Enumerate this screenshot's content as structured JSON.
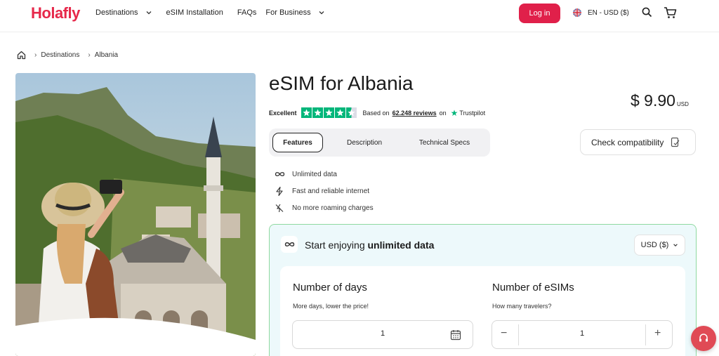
{
  "header": {
    "logo": "Holafly",
    "nav": [
      {
        "label": "Destinations",
        "has_dropdown": true
      },
      {
        "label": "eSIM Installation",
        "has_dropdown": false
      },
      {
        "label": "FAQs",
        "has_dropdown": false
      },
      {
        "label": "For Business",
        "has_dropdown": true
      }
    ],
    "login_label": "Log in",
    "language_label": "EN - USD ($)",
    "icons": [
      "search-icon",
      "cart-icon"
    ]
  },
  "breadcrumb": {
    "home_icon": "home-icon",
    "items": [
      "Destinations",
      "Albania"
    ]
  },
  "product": {
    "title": "eSIM for Albania",
    "price": "$ 9.90",
    "price_currency": "USD",
    "rating": {
      "label": "Excellent",
      "stars": 4.5,
      "based_on": "Based on",
      "reviews": "62.248 reviews",
      "on": "on",
      "provider": "Trustpilot"
    },
    "tabs": [
      {
        "label": "Features",
        "active": true
      },
      {
        "label": "Description",
        "active": false
      },
      {
        "label": "Technical Specs",
        "active": false
      }
    ],
    "check_compatibility": "Check compatibility",
    "features": [
      {
        "icon": "infinity-icon",
        "label": "Unlimited data"
      },
      {
        "icon": "lightning-icon",
        "label": "Fast and reliable internet"
      },
      {
        "icon": "no-roaming-icon",
        "label": "No more roaming charges"
      }
    ]
  },
  "plan": {
    "title_prefix": "Start enjoying",
    "title_bold": "unlimited data",
    "currency": "USD ($)",
    "days": {
      "title": "Number of days",
      "subtitle": "More days, lower the price!",
      "value": "1"
    },
    "esims": {
      "title": "Number of eSIMs",
      "subtitle": "How many travelers?",
      "value": "1",
      "minus": "−",
      "plus": "+"
    }
  },
  "colors": {
    "brand": "#e0204a",
    "trustpilot": "#00b67a",
    "plan_bg": "#edf9fb",
    "plan_border": "#8fd9a0"
  }
}
